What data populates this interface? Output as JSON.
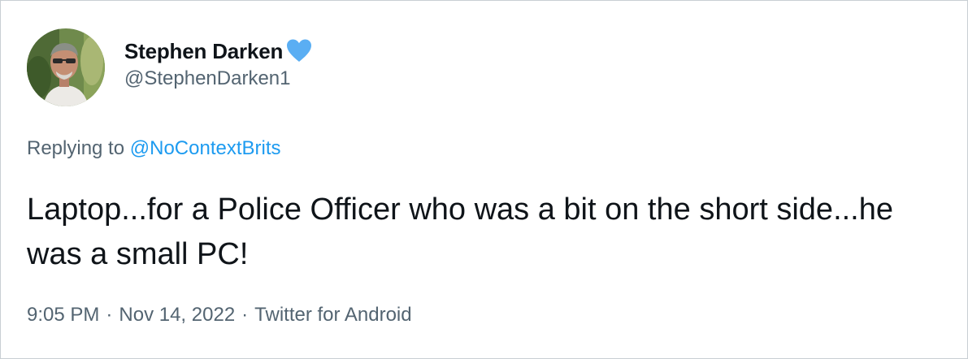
{
  "author": {
    "name": "Stephen Darken",
    "handle": "@StephenDarken1",
    "badge_color": "#5aaef3",
    "avatar_icon": "profile-photo"
  },
  "reply": {
    "prefix": "Replying to ",
    "mention": "@NoContextBrits"
  },
  "tweet": {
    "text": "Laptop...for a Police Officer who was a bit on the short side...he was a small PC!"
  },
  "meta": {
    "time": "9:05 PM",
    "separator": "·",
    "date": "Nov 14, 2022",
    "source": "Twitter for Android"
  },
  "colors": {
    "text_primary": "#0f1419",
    "text_secondary": "#536471",
    "link": "#1d9bf0",
    "border": "#c8ced3"
  }
}
